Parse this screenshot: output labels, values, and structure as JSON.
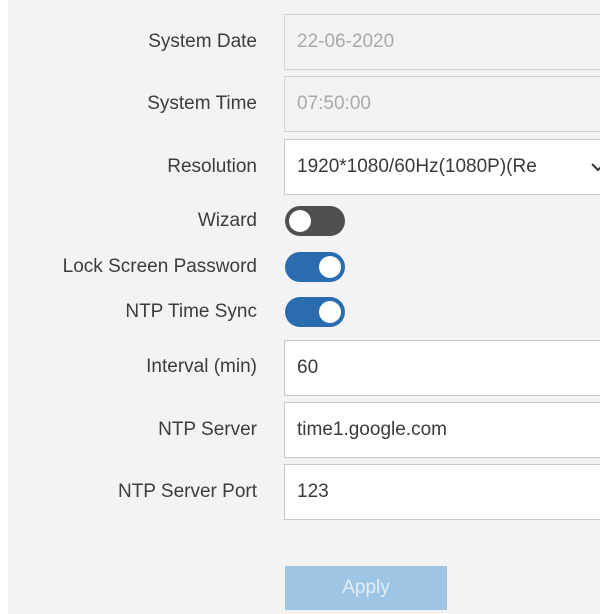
{
  "settings": {
    "system_date": {
      "label": "System Date",
      "value": "22-06-2020"
    },
    "system_time": {
      "label": "System Time",
      "value": "07:50:00"
    },
    "resolution": {
      "label": "Resolution",
      "value": "1920*1080/60Hz(1080P)(Re"
    },
    "wizard": {
      "label": "Wizard",
      "enabled": false
    },
    "lock_screen_password": {
      "label": "Lock Screen Password",
      "enabled": true
    },
    "ntp_time_sync": {
      "label": "NTP Time Sync",
      "enabled": true
    },
    "interval": {
      "label": "Interval (min)",
      "value": "60"
    },
    "ntp_server": {
      "label": "NTP Server",
      "value": "time1.google.com"
    },
    "ntp_server_port": {
      "label": "NTP Server Port",
      "value": "123"
    }
  },
  "actions": {
    "apply_label": "Apply"
  },
  "colors": {
    "toggle_on": "#2b6cb0",
    "toggle_off": "#4f4f4f",
    "apply_button": "#9ec6e4"
  },
  "icons": {
    "resolution_dropdown": "chevron-down-icon"
  }
}
